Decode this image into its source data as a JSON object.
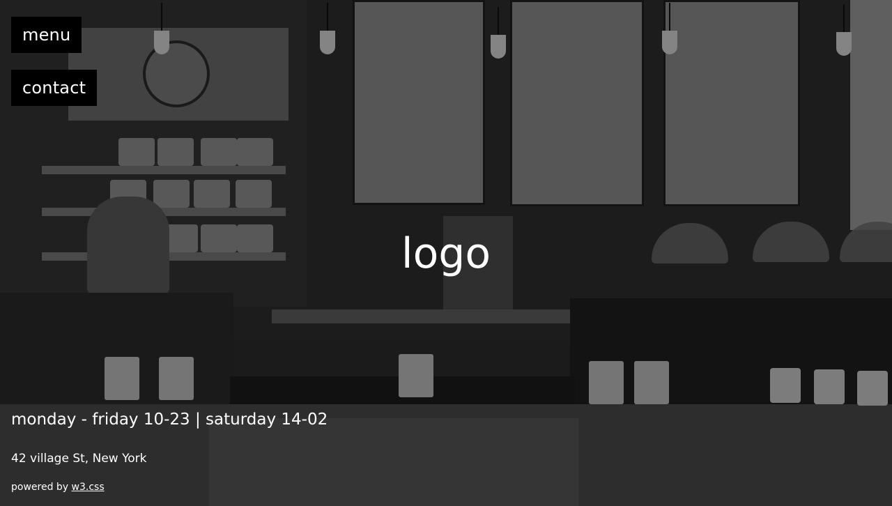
{
  "nav": {
    "menu_label": "menu",
    "contact_label": "contact"
  },
  "hero": {
    "logo_text": "logo",
    "hours_text": "monday - friday 10-23 | saturday 14-02",
    "address_text": "42 village St, New York"
  },
  "footer": {
    "powered_prefix": "powered by ",
    "powered_link": "w3.css"
  },
  "colors": {
    "button_bg": "#000000",
    "text": "#ffffff"
  }
}
